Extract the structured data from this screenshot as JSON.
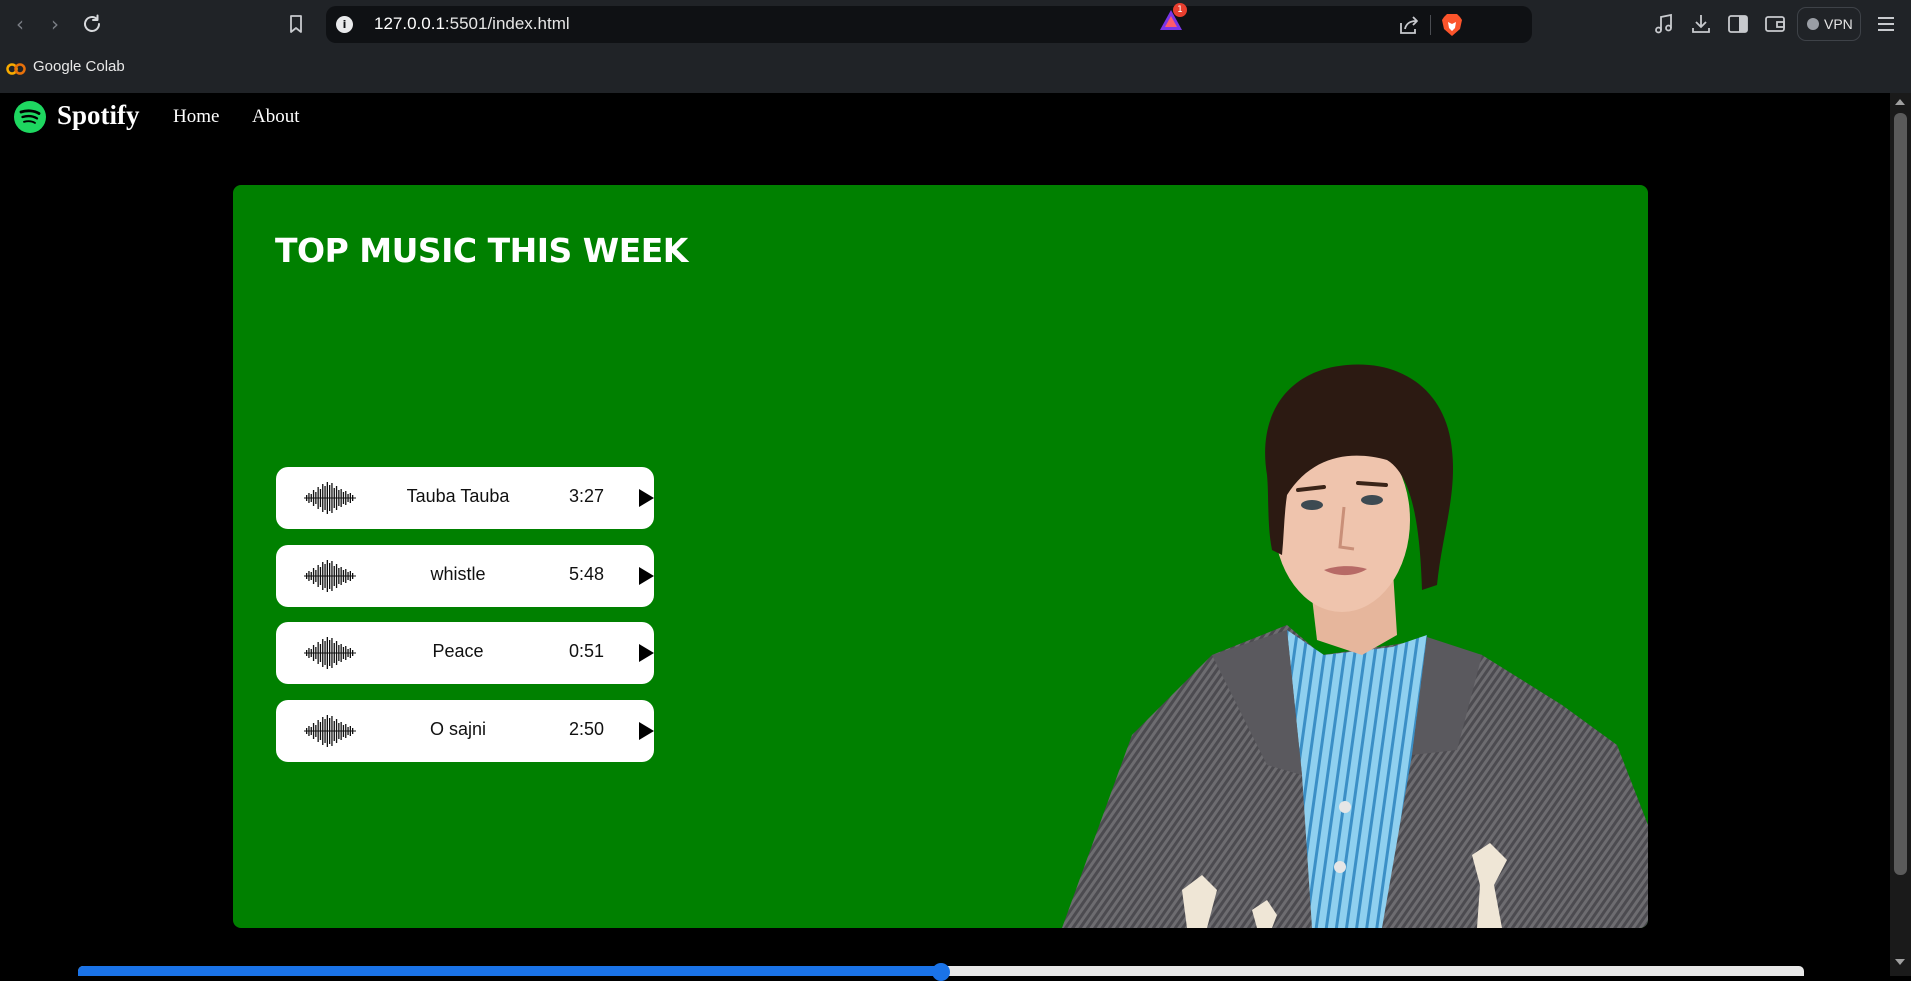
{
  "browser": {
    "url_host": "127.0.0.1",
    "url_path": ":5501/index.html",
    "rewards_badge": "1",
    "vpn_label": "VPN",
    "bookmarks": [
      {
        "label": "Google Colab",
        "icon": "colab-icon"
      }
    ]
  },
  "nav": {
    "logo_text": "Spotify",
    "links": [
      "Home",
      "About"
    ]
  },
  "hero": {
    "title": "TOP MUSIC THIS WEEK",
    "songs": [
      {
        "name": "Tauba Tauba",
        "duration": "3:27"
      },
      {
        "name": "whistle",
        "duration": "5:48"
      },
      {
        "name": "Peace",
        "duration": "0:51"
      },
      {
        "name": "O sajni",
        "duration": "2:50"
      }
    ]
  },
  "player": {
    "progress_percent": 50
  },
  "colors": {
    "hero_background": "#008000",
    "spotify_green": "#1ed760",
    "progress_blue": "#1a73e8"
  }
}
